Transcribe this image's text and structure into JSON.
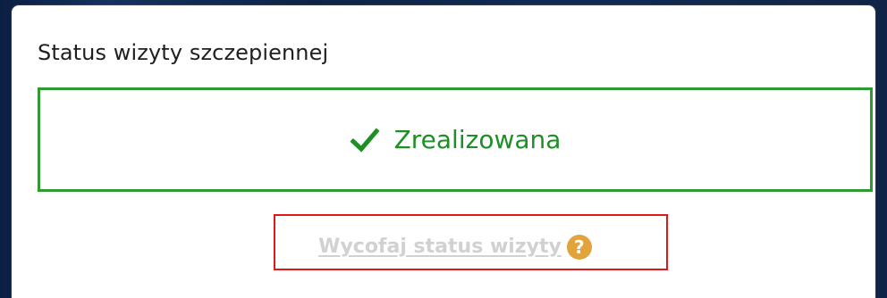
{
  "visit_status": {
    "title": "Status wizyty szczepiennej",
    "status_label": "Zrealizowana",
    "status_icon": "check-icon",
    "withdraw_link_label": "Wycofaj status wizyty",
    "help_icon": "help-icon",
    "help_glyph": "?"
  },
  "colors": {
    "accent_success": "#1e8f24",
    "border_success": "#2e9b32",
    "help_icon_bg": "#e3a33c",
    "highlight_frame": "#e01818",
    "disabled_link": "#d1d1d1",
    "background": "#0f2548"
  }
}
